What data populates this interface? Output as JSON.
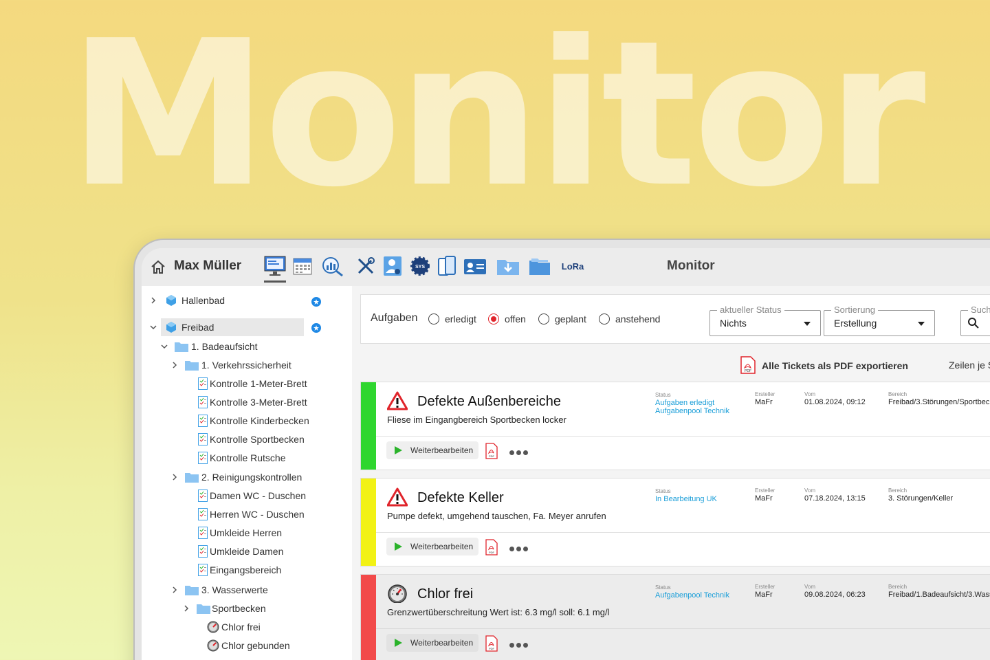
{
  "hero_title": "Monitor",
  "topbar": {
    "user_name": "Max Müller",
    "title": "Monitor",
    "icons": [
      "home-icon",
      "monitor-icon",
      "calendar-icon",
      "analytics-icon",
      "tools-icon",
      "user-settings-icon",
      "sys-gear-icon",
      "mobile-devices-icon",
      "contact-card-icon",
      "download-folder-icon",
      "folders-icon",
      "lora-icon"
    ],
    "lora_label": "LoRa",
    "sys_label": "SYS"
  },
  "sidebar": {
    "items": [
      {
        "label": "Hallenbad"
      },
      {
        "label": "Freibad"
      },
      {
        "label": "1. Badeaufsicht"
      },
      {
        "label": "1. Verkehrssicherheit"
      },
      {
        "label": "Kontrolle 1-Meter-Brett"
      },
      {
        "label": "Kontrolle 3-Meter-Brett"
      },
      {
        "label": "Kontrolle Kinderbecken"
      },
      {
        "label": "Kontrolle Sportbecken"
      },
      {
        "label": "Kontrolle Rutsche"
      },
      {
        "label": "2. Reinigungskontrollen"
      },
      {
        "label": "Damen WC - Duschen"
      },
      {
        "label": "Herren WC - Duschen"
      },
      {
        "label": "Umkleide Herren"
      },
      {
        "label": "Umkleide Damen"
      },
      {
        "label": "Eingangsbereich"
      },
      {
        "label": "3. Wasserwerte"
      },
      {
        "label": "Sportbecken"
      },
      {
        "label": "Chlor frei"
      },
      {
        "label": "Chlor gebunden"
      }
    ]
  },
  "filter": {
    "label": "Aufgaben",
    "radios": [
      {
        "label": "erledigt",
        "checked": false
      },
      {
        "label": "offen",
        "checked": true
      },
      {
        "label": "geplant",
        "checked": false
      },
      {
        "label": "anstehend",
        "checked": false
      }
    ],
    "status_select": {
      "legend": "aktueller Status",
      "value": "Nichts"
    },
    "sort_select": {
      "legend": "Sortierung",
      "value": "Erstellung"
    },
    "search_legend": "Such"
  },
  "export": {
    "label": "Alle Tickets als PDF exportieren",
    "rows_label": "Zeilen je S"
  },
  "meta_labels": {
    "status": "Status",
    "creator": "Ersteller",
    "date": "Vom",
    "area": "Bereich"
  },
  "action_label": "Weiterbearbeiten",
  "pdf_mini": "PDF",
  "tickets": [
    {
      "title": "Defekte Außenbereiche",
      "description": "Fliese im Eingangbereich Sportbecken locker",
      "status_lines": [
        "Aufgaben erledigt",
        "Aufgabenpool Technik"
      ],
      "creator": "MaFr",
      "date": "01.08.2024, 09:12",
      "area": "Freibad/3.Störungen/Sportbeck",
      "color": "#2fd62f",
      "icon": "warning-icon"
    },
    {
      "title": "Defekte Keller",
      "description": "Pumpe defekt, umgehend tauschen, Fa. Meyer anrufen",
      "status_lines": [
        "In Bearbeitung UK"
      ],
      "creator": "MaFr",
      "date": "07.18.2024, 13:15",
      "area": "3. Störungen/Keller",
      "color": "#f2f215",
      "icon": "warning-icon"
    },
    {
      "title": "Chlor frei",
      "description": "Grenzwertüberschreitung Wert ist: 6.3 mg/l  soll: 6.1 mg/l",
      "status_lines": [
        "Aufgabenpool Technik"
      ],
      "creator": "MaFr",
      "date": "09.08.2024, 06:23",
      "area": "Freibad/1.Badeaufsicht/3.Wass",
      "color": "#f24a4a",
      "icon": "gauge-icon"
    }
  ]
}
